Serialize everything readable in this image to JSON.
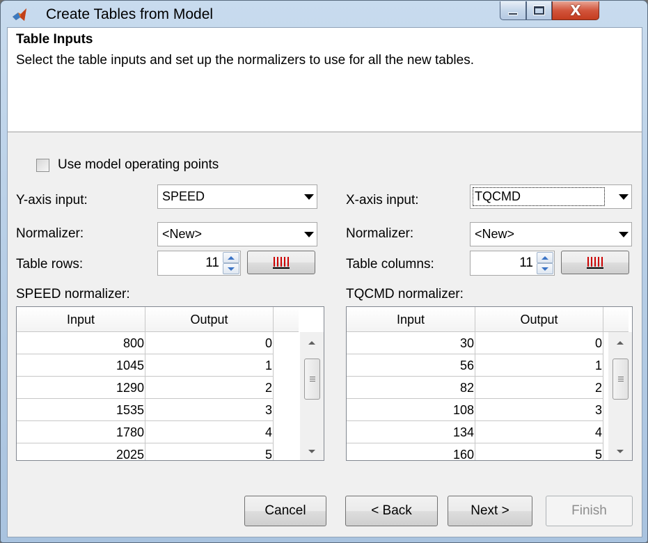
{
  "window": {
    "title": "Create Tables from Model",
    "close_glyph": "X"
  },
  "header": {
    "title": "Table Inputs",
    "description": "Select the table inputs and set up the normalizers to use for all the new tables."
  },
  "options": {
    "use_model_operating_points": {
      "label": "Use model operating points",
      "checked": false
    }
  },
  "y_axis": {
    "input_label": "Y-axis input:",
    "input_value": "SPEED",
    "normalizer_label": "Normalizer:",
    "normalizer_value": "<New>",
    "count_label": "Table rows:",
    "count_value": "11",
    "normalizer_table_label": "SPEED normalizer:",
    "columns": [
      "Input",
      "Output"
    ],
    "rows": [
      [
        "800",
        "0"
      ],
      [
        "1045",
        "1"
      ],
      [
        "1290",
        "2"
      ],
      [
        "1535",
        "3"
      ],
      [
        "1780",
        "4"
      ],
      [
        "2025",
        "5"
      ]
    ]
  },
  "x_axis": {
    "input_label": "X-axis input:",
    "input_value": "TQCMD",
    "normalizer_label": "Normalizer:",
    "normalizer_value": "<New>",
    "count_label": "Table columns:",
    "count_value": "11",
    "normalizer_table_label": "TQCMD normalizer:",
    "columns": [
      "Input",
      "Output"
    ],
    "rows": [
      [
        "30",
        "0"
      ],
      [
        "56",
        "1"
      ],
      [
        "82",
        "2"
      ],
      [
        "108",
        "3"
      ],
      [
        "134",
        "4"
      ],
      [
        "160",
        "5"
      ]
    ]
  },
  "buttons": {
    "cancel": "Cancel",
    "back": "< Back",
    "next": "Next >",
    "finish": "Finish"
  },
  "colors": {
    "spacing_icon": "#cc0000",
    "spinner_arrow": "#3b74c6"
  }
}
